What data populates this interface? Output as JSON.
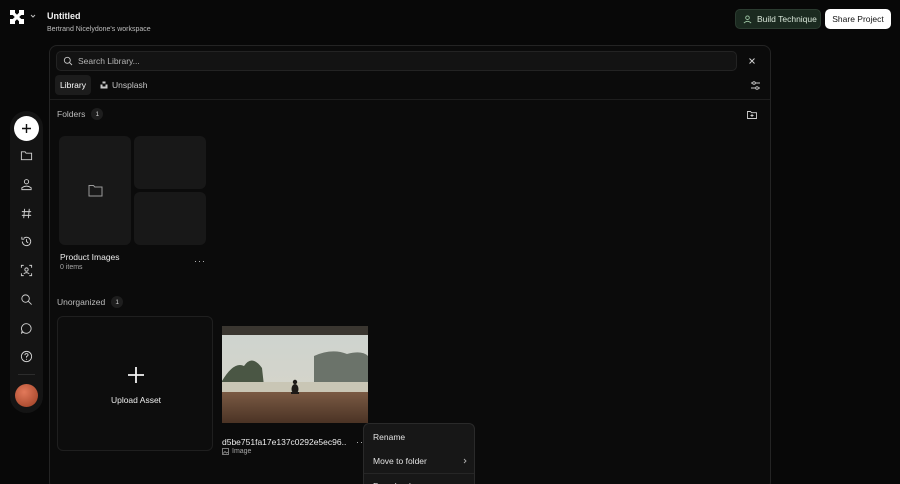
{
  "header": {
    "title": "Untitled",
    "workspace": "Bertrand Nicelydone's workspace",
    "build_label": "Build Technique",
    "share_label": "Share Project"
  },
  "library": {
    "search_placeholder": "Search Library...",
    "tabs": [
      {
        "label": "Library",
        "active": true
      },
      {
        "label": "Unsplash",
        "active": false
      }
    ],
    "folders_section": {
      "label": "Folders",
      "count": "1"
    },
    "folders": [
      {
        "name": "Product Images",
        "item_count": "0 items"
      }
    ],
    "unorganized_section": {
      "label": "Unorganized",
      "count": "1"
    },
    "upload_label": "Upload Asset",
    "assets": [
      {
        "name": "d5be751fa17e137c0292e5ec96...",
        "type": "Image"
      }
    ]
  },
  "context_menu": {
    "items": [
      {
        "label": "Rename"
      },
      {
        "label": "Move to folder"
      },
      {
        "label": "Download"
      }
    ]
  },
  "icons": {
    "rail": [
      "plus-icon",
      "folder-icon",
      "person-icon",
      "hash-icon",
      "history-icon",
      "scan-face-icon",
      "search-icon",
      "chat-icon",
      "help-icon"
    ]
  },
  "colors": {
    "background": "#080808",
    "panel": "#0b0b0b",
    "build_button_bg": "#1b2a20",
    "share_button_bg": "#ffffff",
    "avatar": "#c75a3b"
  }
}
